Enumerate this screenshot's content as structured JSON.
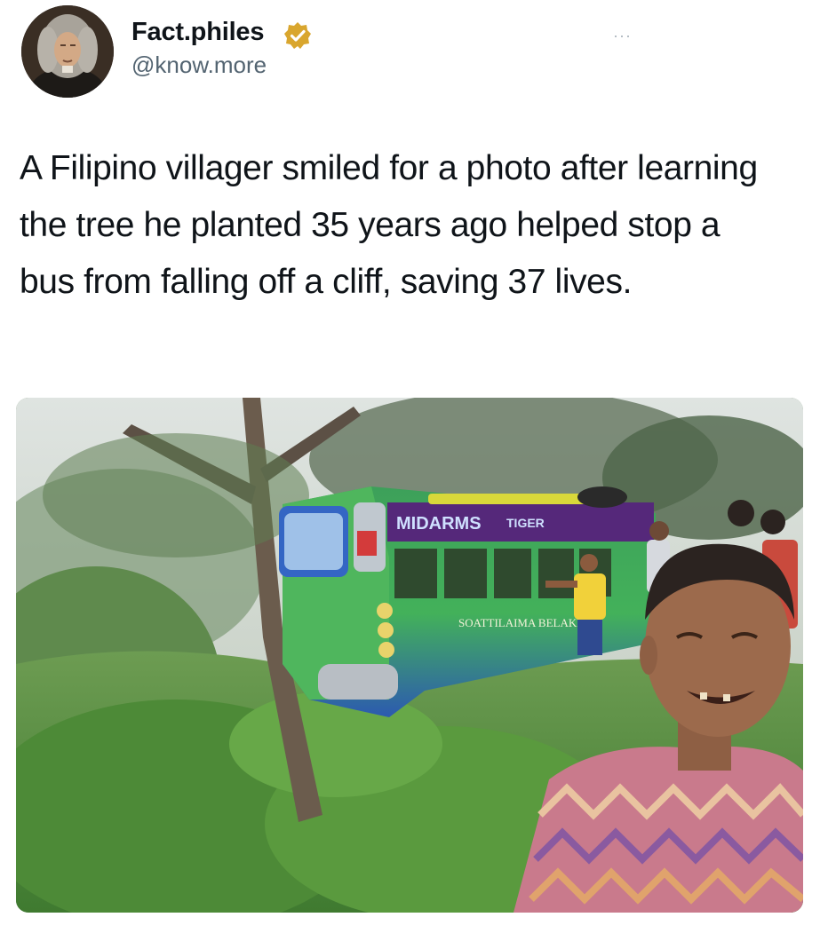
{
  "tweet": {
    "author": {
      "display_name": "Fact.philes",
      "handle": "@know.more",
      "verified": true,
      "avatar_icon": "avatar-portrait"
    },
    "more_label": "···",
    "text": "A Filipino villager smiled for a photo after learning the tree he planted 35 years ago helped stop a bus from falling off a cliff, saving 37 lives.",
    "media": {
      "bus_signs": {
        "front_left": "MIDARMS",
        "front_right": "TIGER",
        "side": "SOATTILAIMA BELAKE"
      }
    }
  },
  "colors": {
    "verified_badge": "#d9a62e",
    "text_primary": "#0f1419",
    "text_secondary": "#536471",
    "bus_green": "#3c9b4a",
    "bus_blue": "#2451a8"
  }
}
